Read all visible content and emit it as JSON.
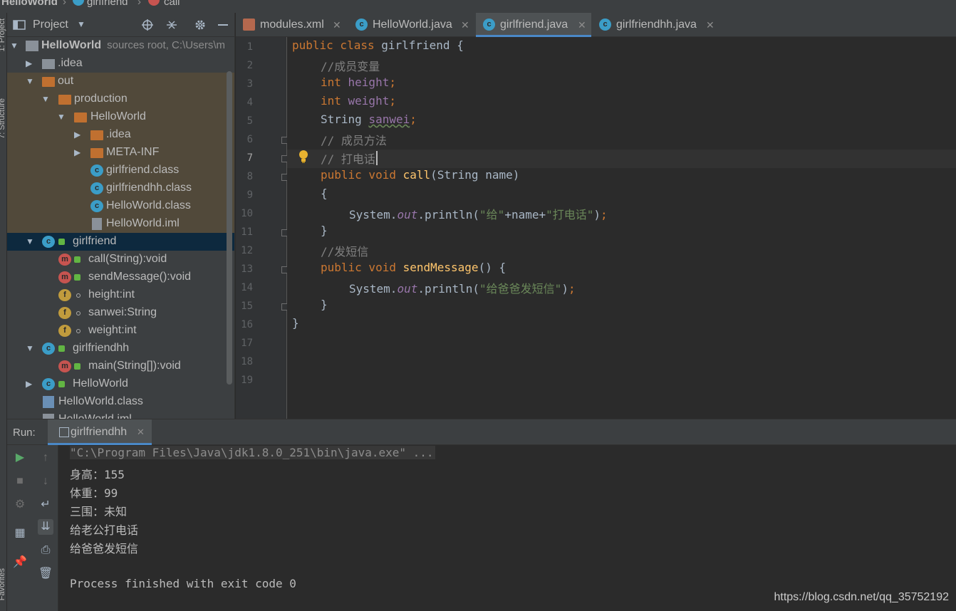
{
  "breadcrumb": {
    "project": "HelloWorld",
    "class": "girlfriend",
    "method": "call"
  },
  "left_strip": {
    "project_label": "1: Project",
    "structure_label": "7: Structure",
    "favorites_label": "Favorites"
  },
  "project_panel": {
    "title": "Project",
    "root": {
      "name": "HelloWorld",
      "extra": "sources root,  C:\\Users\\m"
    },
    "items": [
      {
        "label": ".idea"
      },
      {
        "label": "out"
      },
      {
        "label": "production"
      },
      {
        "label": "HelloWorld"
      },
      {
        "label": ".idea"
      },
      {
        "label": "META-INF"
      },
      {
        "label": "girlfriend.class"
      },
      {
        "label": "girlfriendhh.class"
      },
      {
        "label": "HelloWorld.class"
      },
      {
        "label": "HelloWorld.iml"
      },
      {
        "label": "girlfriend"
      },
      {
        "label": "call(String):void"
      },
      {
        "label": "sendMessage():void"
      },
      {
        "label": "height:int"
      },
      {
        "label": "sanwei:String"
      },
      {
        "label": "weight:int"
      },
      {
        "label": "girlfriendhh"
      },
      {
        "label": "main(String[]):void"
      },
      {
        "label": "HelloWorld"
      },
      {
        "label": "HelloWorld.class"
      },
      {
        "label": "HelloWorld.iml"
      }
    ]
  },
  "editor_tabs": [
    {
      "label": "modules.xml",
      "icon": "xml-file-icon"
    },
    {
      "label": "HelloWorld.java",
      "icon": "java-class-icon"
    },
    {
      "label": "girlfriend.java",
      "icon": "java-class-icon",
      "active": true
    },
    {
      "label": "girlfriendhh.java",
      "icon": "java-class-icon"
    }
  ],
  "editor": {
    "line_numbers": [
      "1",
      "2",
      "3",
      "4",
      "5",
      "6",
      "7",
      "8",
      "9",
      "10",
      "11",
      "12",
      "13",
      "14",
      "15",
      "16",
      "17",
      "18",
      "19"
    ],
    "current_line": "7",
    "code": {
      "l1_kw": "public class ",
      "l1_rest": "girlfriend {",
      "l2": "//成员变量",
      "l3_kw": "int ",
      "l3_field": "height",
      "l3_semi": ";",
      "l4_kw": "int ",
      "l4_field": "weight",
      "l4_semi": ";",
      "l5_type": "String ",
      "l5_field": "sanwei",
      "l5_semi": ";",
      "l6": "// 成员方法",
      "l7": "// 打电话",
      "l8_kw": "public void ",
      "l8_meth": "call",
      "l8_rest": "(String name)",
      "l9": "{",
      "l10_a": "System.",
      "l10_out": "out",
      "l10_b": ".println(",
      "l10_s1": "\"给\"",
      "l10_c": "+name+",
      "l10_s2": "\"打电话\"",
      "l10_d": ")",
      "l10_semi": ";",
      "l11": "}",
      "l12": "//发短信",
      "l13_kw": "public void ",
      "l13_meth": "sendMessage",
      "l13_rest": "() {",
      "l14_a": "System.",
      "l14_out": "out",
      "l14_b": ".println(",
      "l14_s": "\"给爸爸发短信\"",
      "l14_d": ")",
      "l14_semi": ";",
      "l15": "}",
      "l16": "}"
    }
  },
  "run_panel": {
    "label": "Run:",
    "tab": "girlfriendhh",
    "console": [
      "\"C:\\Program Files\\Java\\jdk1.8.0_251\\bin\\java.exe\" ...",
      "身高：155",
      "体重：99",
      "三围：未知",
      "给老公打电话",
      "给爸爸发短信",
      "",
      "Process finished with exit code 0"
    ]
  },
  "watermark": "https://blog.csdn.net/qq_35752192",
  "colors": {
    "keyword": "#cc7832",
    "field": "#9876aa",
    "comment": "#808080",
    "string": "#6a8759",
    "method": "#ffc66d",
    "accent": "#4a88c7"
  }
}
